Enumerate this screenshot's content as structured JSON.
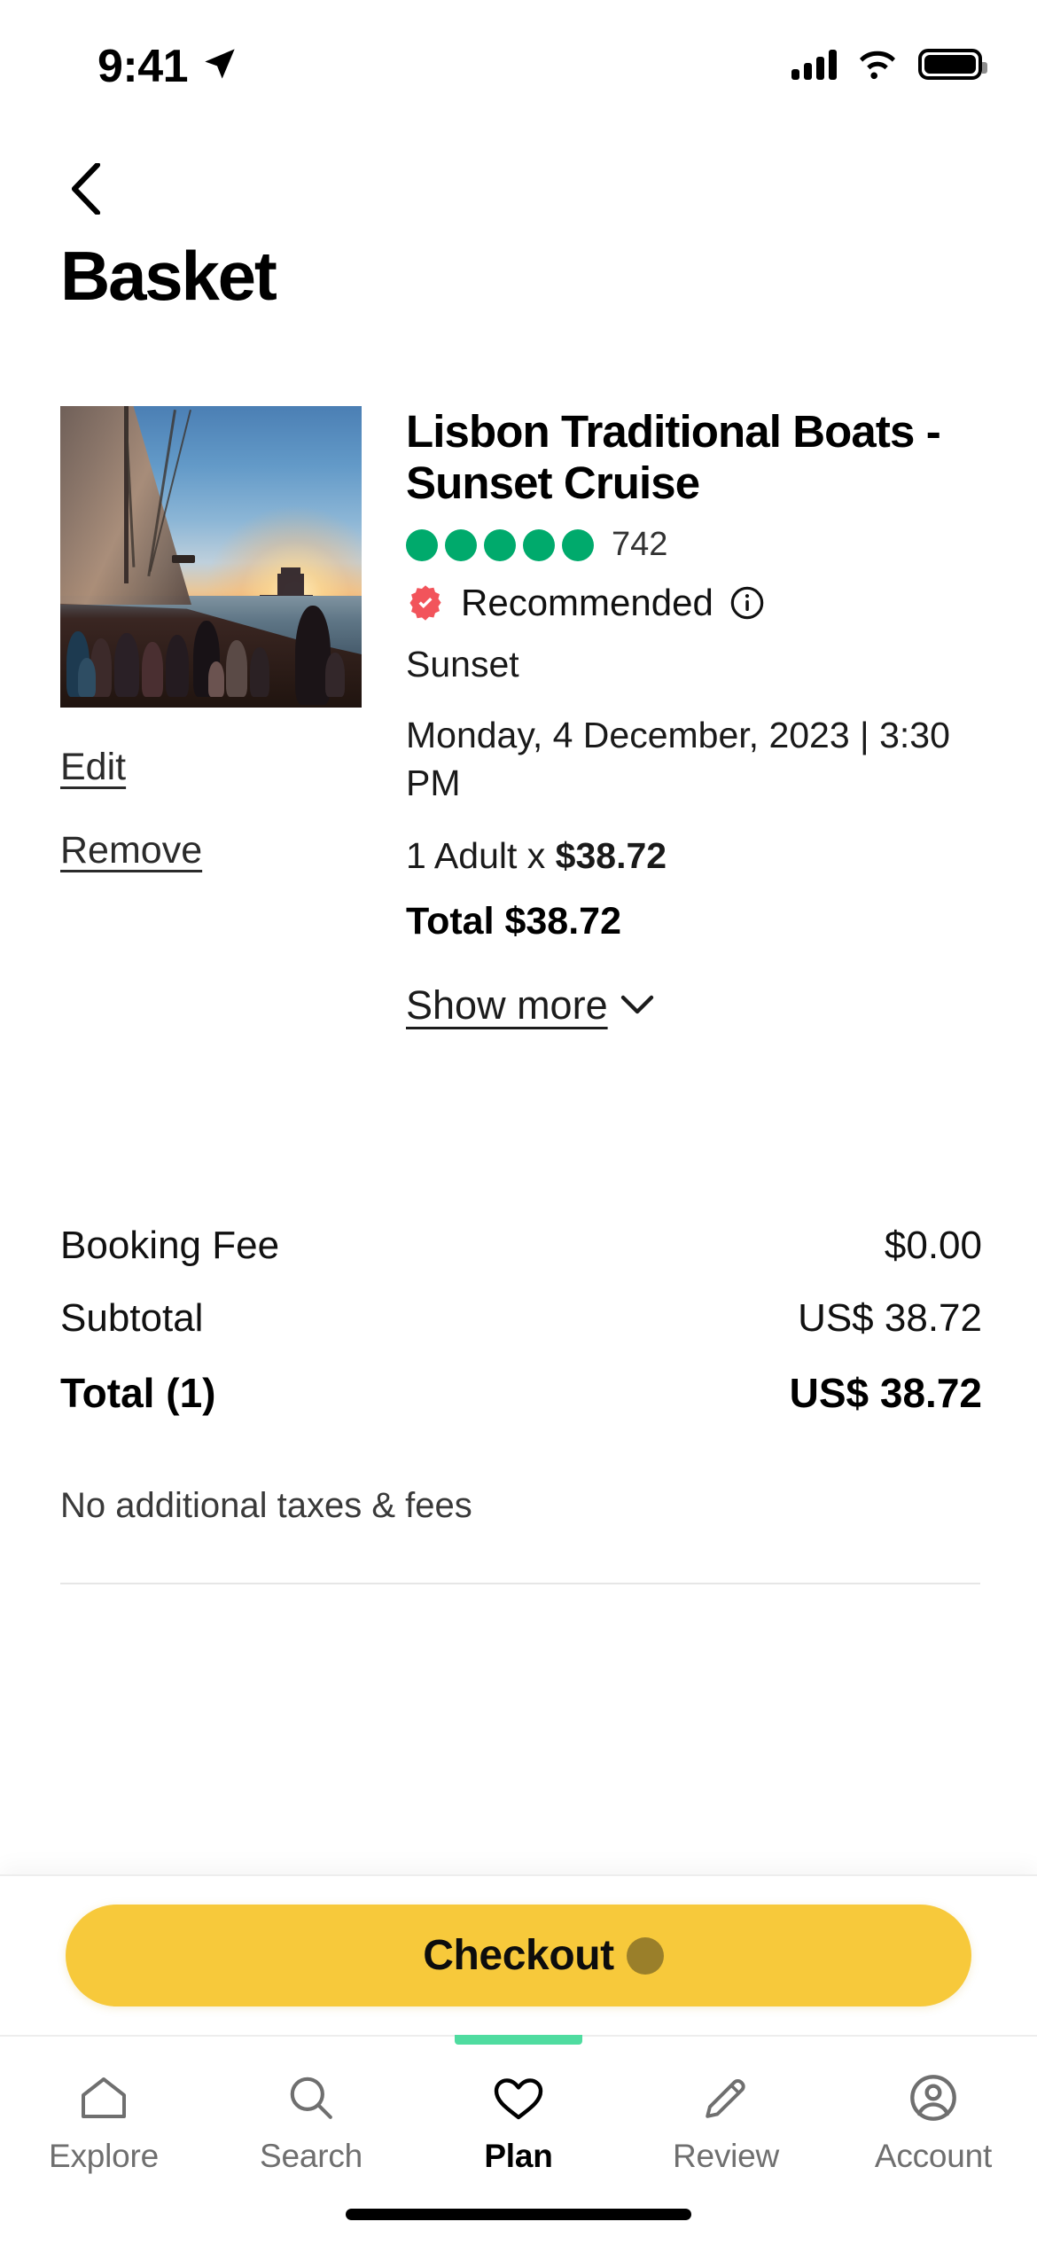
{
  "status_bar": {
    "time": "9:41",
    "location_icon": "location-arrow-icon",
    "signal_icon": "cellular-signal-icon",
    "wifi_icon": "wifi-icon",
    "battery_icon": "battery-full-icon"
  },
  "header": {
    "back_icon": "chevron-left-icon",
    "title": "Basket"
  },
  "basket_item": {
    "image_alt": "sunset-sailboat-cruise-photo",
    "title": "Lisbon Traditional Boats - Sunset Cruise",
    "rating": {
      "bubbles": 5,
      "bubble_color": "#00AA6C",
      "review_count": "742"
    },
    "badge": {
      "icon": "verified-check-badge-icon",
      "color": "#F2545B",
      "label": "Recommended",
      "info_icon": "info-circle-icon"
    },
    "option_name": "Sunset",
    "datetime": "Monday, 4 December, 2023 | 3:30 PM",
    "pax_prefix": "1 Adult x ",
    "pax_price": "$38.72",
    "item_total": "Total $38.72",
    "edit_label": "Edit",
    "remove_label": "Remove",
    "show_more_label": "Show more",
    "show_more_icon": "chevron-down-icon"
  },
  "summary": {
    "rows": [
      {
        "label": "Booking Fee",
        "value": "$0.00"
      },
      {
        "label": "Subtotal",
        "value": "US$ 38.72"
      }
    ],
    "total": {
      "label": "Total (1)",
      "value": "US$ 38.72"
    },
    "tax_note": "No additional taxes & fees"
  },
  "checkout": {
    "label": "Checkout",
    "color": "#F7C93B"
  },
  "tabbar": {
    "active_indicator_color": "#4FDCA0",
    "items": [
      {
        "label": "Explore",
        "icon": "home-icon",
        "active": false
      },
      {
        "label": "Search",
        "icon": "search-icon",
        "active": false
      },
      {
        "label": "Plan",
        "icon": "heart-icon",
        "active": true
      },
      {
        "label": "Review",
        "icon": "pencil-icon",
        "active": false
      },
      {
        "label": "Account",
        "icon": "account-circle-icon",
        "active": false
      }
    ]
  }
}
